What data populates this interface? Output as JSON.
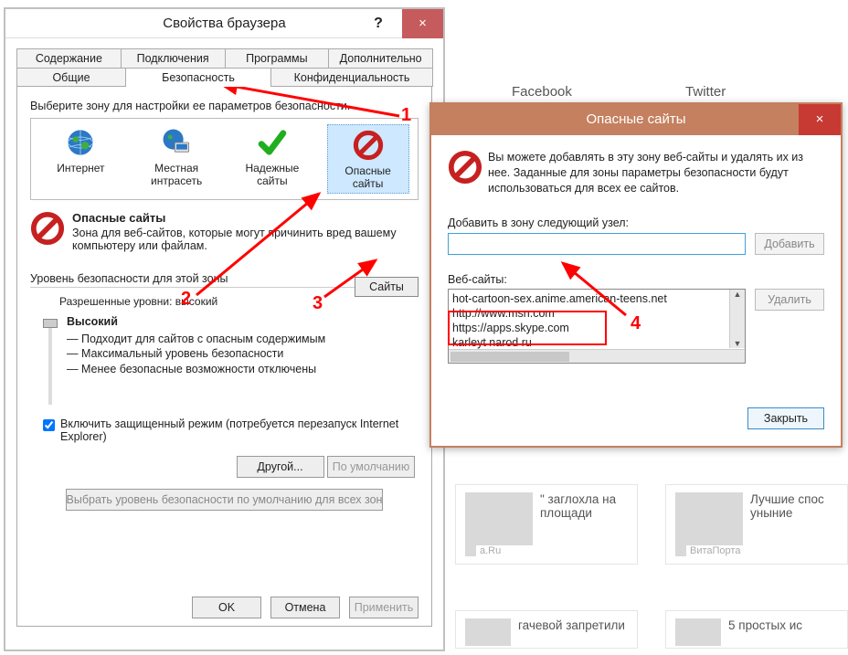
{
  "bg": {
    "facebook": "Facebook",
    "twitter": "Twitter",
    "card1_title": "\" заглохла на площади",
    "card1_src": "а.Ru",
    "card2_title": "Лучшие спос уныние",
    "card2_src": "ВитаПорта",
    "card3_title": "гачевой запретили",
    "card4_title": "5 простых ис"
  },
  "annotations": {
    "n1": "1",
    "n2": "2",
    "n3": "3",
    "n4": "4"
  },
  "main": {
    "title": "Свойства браузера",
    "help": "?",
    "close": "×",
    "tabs_top": [
      "Содержание",
      "Подключения",
      "Программы",
      "Дополнительно"
    ],
    "tabs_bot": [
      "Общие",
      "Безопасность",
      "Конфиденциальность"
    ],
    "active_tab": "Безопасность",
    "zone_prompt": "Выберите зону для настройки ее параметров безопасности.",
    "zones": [
      {
        "name": "Интернет",
        "icon": "globe"
      },
      {
        "name": "Местная интрасеть",
        "icon": "globe-shield"
      },
      {
        "name": "Надежные сайты",
        "icon": "check"
      },
      {
        "name": "Опасные сайты",
        "icon": "block"
      }
    ],
    "zone_title": "Опасные сайты",
    "zone_desc": "Зона для веб-сайтов, которые могут причинить вред вашему компьютеру или файлам.",
    "sites_btn": "Сайты",
    "sec_group": "Уровень безопасности для этой зоны",
    "allowed": "Разрешенные уровни: высокий",
    "level_name": "Высокий",
    "level_pts": [
      "— Подходит для сайтов с опасным содержимым",
      "— Максимальный уровень безопасности",
      "— Менее безопасные возможности отключены"
    ],
    "protected": "Включить защищенный режим (потребуется перезапуск Internet Explorer)",
    "protected_checked": true,
    "custom_btn": "Другой...",
    "default_btn": "По умолчанию",
    "reset_btn": "Выбрать уровень безопасности по умолчанию для всех зон",
    "ok": "OK",
    "cancel": "Отмена",
    "apply": "Применить"
  },
  "rest": {
    "title": "Опасные сайты",
    "close": "×",
    "intro": "Вы можете добавлять в эту зону  веб-сайты и удалять их из нее. Заданные для зоны параметры безопасности будут использоваться для всех ее сайтов.",
    "add_label": "Добавить в зону следующий узел:",
    "add_btn": "Добавить",
    "list_label": "Веб-сайты:",
    "sites": [
      "hot-cartoon-sex.anime.american-teens.net",
      "http://www.msn.com",
      "https://apps.skype.com",
      "karleyt narod ru"
    ],
    "remove_btn": "Удалить",
    "close_btn": "Закрыть"
  }
}
